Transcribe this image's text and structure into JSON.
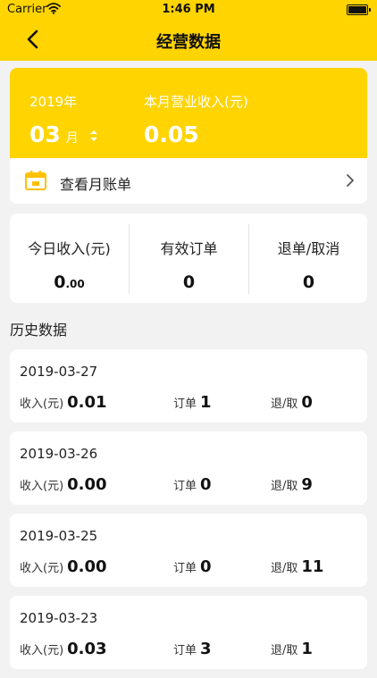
{
  "status_bar": {
    "carrier": "Carrier",
    "time": "1:46 PM"
  },
  "nav": {
    "title": "经营数据"
  },
  "summary": {
    "year": "2019年",
    "month": "03",
    "month_unit": "月",
    "income_label": "本月营业收入(元)",
    "income_value": "0.05",
    "bill_label": "查看月账单"
  },
  "today": {
    "income_label": "今日收入(元)",
    "income_value_main": "0",
    "income_value_decimal": ".00",
    "orders_label": "有效订单",
    "orders_value": "0",
    "refund_label": "退单/取消",
    "refund_value": "0"
  },
  "history": {
    "heading": "历史数据",
    "income_key": "收入(元)",
    "orders_key": "订单",
    "refund_key": "退/取",
    "records": [
      {
        "date": "2019-03-27",
        "income": "0.01",
        "orders": "1",
        "refund": "0"
      },
      {
        "date": "2019-03-26",
        "income": "0.00",
        "orders": "0",
        "refund": "9"
      },
      {
        "date": "2019-03-25",
        "income": "0.00",
        "orders": "0",
        "refund": "11"
      },
      {
        "date": "2019-03-23",
        "income": "0.03",
        "orders": "3",
        "refund": "1"
      }
    ]
  },
  "colors": {
    "accent": "#ffd400",
    "background": "#f2f2f2",
    "card": "#ffffff"
  }
}
